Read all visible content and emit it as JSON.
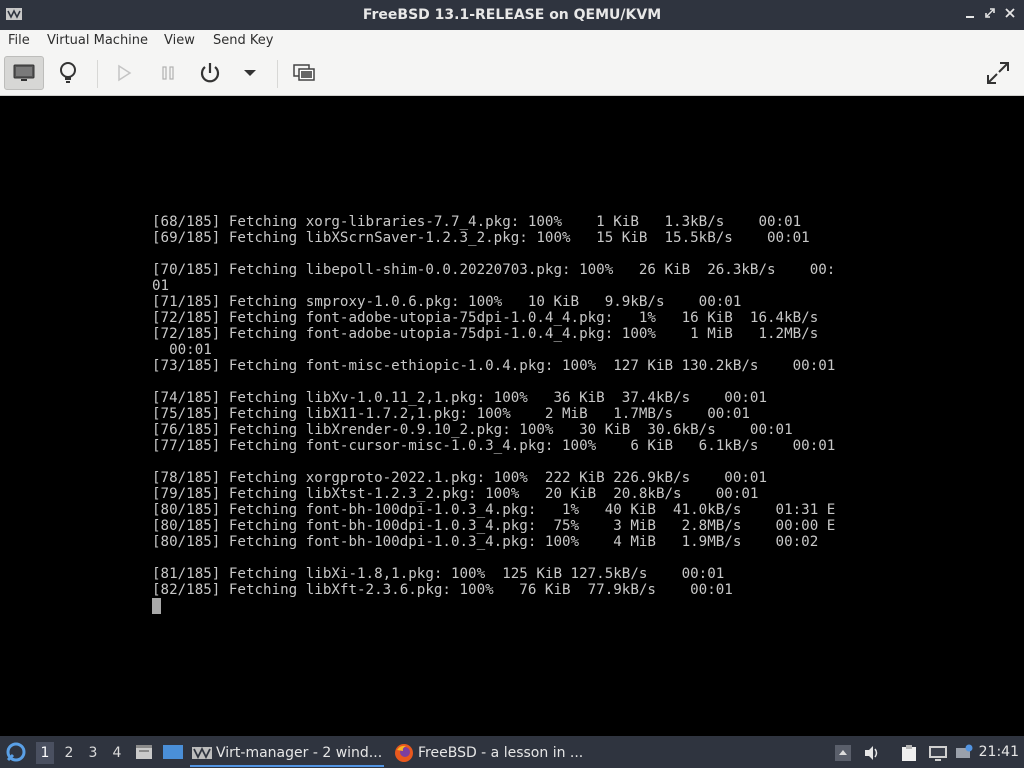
{
  "window": {
    "title": "FreeBSD 13.1-RELEASE on QEMU/KVM"
  },
  "menubar": {
    "items": [
      "File",
      "Virtual Machine",
      "View",
      "Send Key"
    ]
  },
  "toolbar": {
    "buttons": [
      "console-icon",
      "lightbulb-icon",
      "play-icon",
      "pause-icon",
      "power-icon",
      "chevron-down-icon",
      "snapshot-icon",
      "fullscreen-icon"
    ]
  },
  "terminal": {
    "lines": [
      "[68/185] Fetching xorg-libraries-7.7_4.pkg: 100%    1 KiB   1.3kB/s    00:01",
      "[69/185] Fetching libXScrnSaver-1.2.3_2.pkg: 100%   15 KiB  15.5kB/s    00:01",
      "",
      "[70/185] Fetching libepoll-shim-0.0.20220703.pkg: 100%   26 KiB  26.3kB/s    00:",
      "01",
      "[71/185] Fetching smproxy-1.0.6.pkg: 100%   10 KiB   9.9kB/s    00:01",
      "[72/185] Fetching font-adobe-utopia-75dpi-1.0.4_4.pkg:   1%   16 KiB  16.4kB/s",
      "[72/185] Fetching font-adobe-utopia-75dpi-1.0.4_4.pkg: 100%    1 MiB   1.2MB/s",
      "  00:01",
      "[73/185] Fetching font-misc-ethiopic-1.0.4.pkg: 100%  127 KiB 130.2kB/s    00:01",
      "",
      "[74/185] Fetching libXv-1.0.11_2,1.pkg: 100%   36 KiB  37.4kB/s    00:01",
      "[75/185] Fetching libX11-1.7.2,1.pkg: 100%    2 MiB   1.7MB/s    00:01",
      "[76/185] Fetching libXrender-0.9.10_2.pkg: 100%   30 KiB  30.6kB/s    00:01",
      "[77/185] Fetching font-cursor-misc-1.0.3_4.pkg: 100%    6 KiB   6.1kB/s    00:01",
      "",
      "[78/185] Fetching xorgproto-2022.1.pkg: 100%  222 KiB 226.9kB/s    00:01",
      "[79/185] Fetching libXtst-1.2.3_2.pkg: 100%   20 KiB  20.8kB/s    00:01",
      "[80/185] Fetching font-bh-100dpi-1.0.3_4.pkg:   1%   40 KiB  41.0kB/s    01:31 E",
      "[80/185] Fetching font-bh-100dpi-1.0.3_4.pkg:  75%    3 MiB   2.8MB/s    00:00 E",
      "[80/185] Fetching font-bh-100dpi-1.0.3_4.pkg: 100%    4 MiB   1.9MB/s    00:02",
      "",
      "[81/185] Fetching libXi-1.8,1.pkg: 100%  125 KiB 127.5kB/s    00:01",
      "[82/185] Fetching libXft-2.3.6.pkg: 100%   76 KiB  77.9kB/s    00:01"
    ]
  },
  "taskbar": {
    "workspaces": [
      "1",
      "2",
      "3",
      "4"
    ],
    "active_workspace": "1",
    "tasks": [
      {
        "label": "Virt-manager - 2 wind...",
        "icon": "virt-manager-icon"
      },
      {
        "label": "FreeBSD - a lesson in ...",
        "icon": "firefox-icon"
      }
    ],
    "clock": "21:41"
  }
}
